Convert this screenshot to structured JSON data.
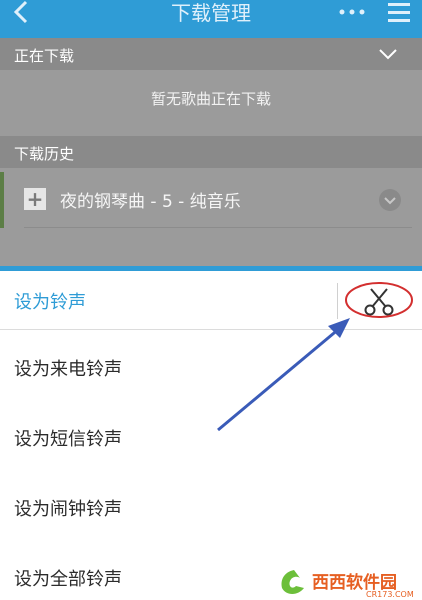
{
  "header": {
    "title": "下载管理",
    "icons": {
      "back": "back-arrow-icon",
      "more": "more-dots-icon",
      "menu": "menu-icon"
    }
  },
  "sections": {
    "downloading": {
      "label": "正在下载",
      "empty_text": "暂无歌曲正在下载"
    },
    "history": {
      "label": "下载历史"
    }
  },
  "history_items": [
    {
      "name": "夜的钢琴曲 - 5 - 纯音乐"
    }
  ],
  "sheet": {
    "title": "设为铃声",
    "options": [
      {
        "label": "设为来电铃声"
      },
      {
        "label": "设为短信铃声"
      },
      {
        "label": "设为闹钟铃声"
      },
      {
        "label": "设为全部铃声"
      }
    ],
    "icons": {
      "cut": "scissors-icon"
    }
  },
  "colors": {
    "accent": "#2f9cd6",
    "annotation_circle": "#d32f2f",
    "annotation_arrow": "#3a5bb8"
  },
  "watermark": {
    "main": "西西软件园",
    "sub": "CR173.COM"
  }
}
